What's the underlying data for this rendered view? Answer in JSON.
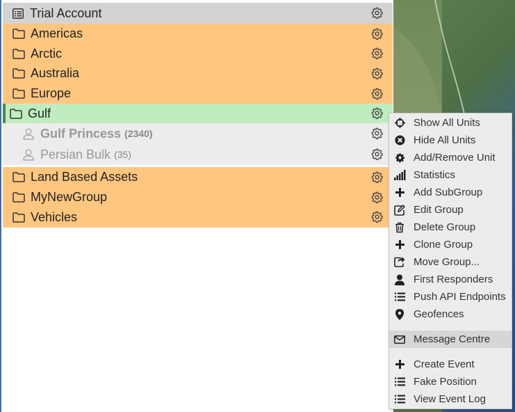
{
  "tree": {
    "account_label": "Trial Account",
    "groups_top": [
      {
        "label": "Americas"
      },
      {
        "label": "Arctic"
      },
      {
        "label": "Australia"
      },
      {
        "label": "Europe"
      }
    ],
    "selected_group": {
      "label": "Gulf"
    },
    "units": [
      {
        "name": "Gulf Princess",
        "count": "(2340)"
      },
      {
        "name": "Persian Bulk",
        "count": "(35)"
      }
    ],
    "groups_bottom": [
      {
        "label": "Land Based Assets"
      },
      {
        "label": "MyNewGroup"
      },
      {
        "label": "Vehicles"
      }
    ]
  },
  "context_menu": {
    "items": [
      {
        "label": "Show All Units",
        "icon": "crosshair-icon"
      },
      {
        "label": "Hide All Units",
        "icon": "x-circle-icon"
      },
      {
        "label": "Add/Remove Unit",
        "icon": "gear-icon"
      },
      {
        "label": "Statistics",
        "icon": "signal-bars-icon"
      },
      {
        "label": "Add SubGroup",
        "icon": "plus-icon"
      },
      {
        "label": "Edit Group",
        "icon": "edit-icon"
      },
      {
        "label": "Delete Group",
        "icon": "trash-icon"
      },
      {
        "label": "Clone Group",
        "icon": "plus-icon"
      },
      {
        "label": "Move Group...",
        "icon": "share-icon"
      },
      {
        "label": "First Responders",
        "icon": "user-icon"
      },
      {
        "label": "Push API Endpoints",
        "icon": "list-icon"
      },
      {
        "label": "Geofences",
        "icon": "map-marker-icon"
      },
      {
        "label": "Message Centre",
        "icon": "envelope-icon"
      },
      {
        "label": "Create Event",
        "icon": "plus-icon"
      },
      {
        "label": "Fake Position",
        "icon": "list-icon"
      },
      {
        "label": "View Event Log",
        "icon": "list-icon"
      }
    ]
  }
}
